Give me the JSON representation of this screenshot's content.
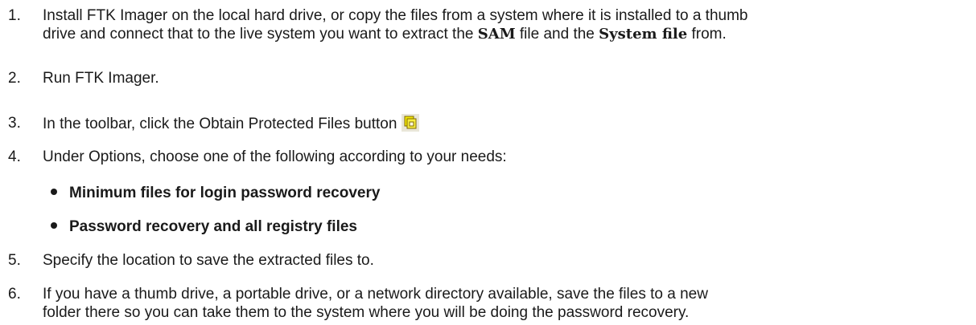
{
  "steps": [
    {
      "number": "1.",
      "line1": "Install FTK Imager on the local hard drive, or copy the files from a system where it is installed to a thumb",
      "line2_a": "drive and connect that to the live system you want to extract the ",
      "sam": "SAM",
      "line2_b": " file and the ",
      "system_file": "System file",
      "line2_c": " from."
    },
    {
      "number": "2.",
      "text": "Run FTK Imager."
    },
    {
      "number": "3.",
      "text": "In the toolbar, click the Obtain Protected Files button",
      "icon": "obtain-protected-files-icon"
    },
    {
      "number": "4.",
      "text": "Under Options, choose one of the following according to your needs:"
    },
    {
      "number": "5.",
      "text": "Specify the location to save the extracted files to."
    },
    {
      "number": "6.",
      "line1": "If you have a thumb drive, a portable drive, or a network directory available, save the files to a new",
      "line2": "folder there so you can take them to the system where you will be doing the password recovery."
    }
  ],
  "options": [
    "Minimum files for login password recovery",
    "Password recovery and all registry files"
  ],
  "colors": {
    "text": "#1a1a1a",
    "icon_bg": "#e9e6d8",
    "icon_yellow": "#f2e600",
    "icon_outline": "#806a00"
  }
}
